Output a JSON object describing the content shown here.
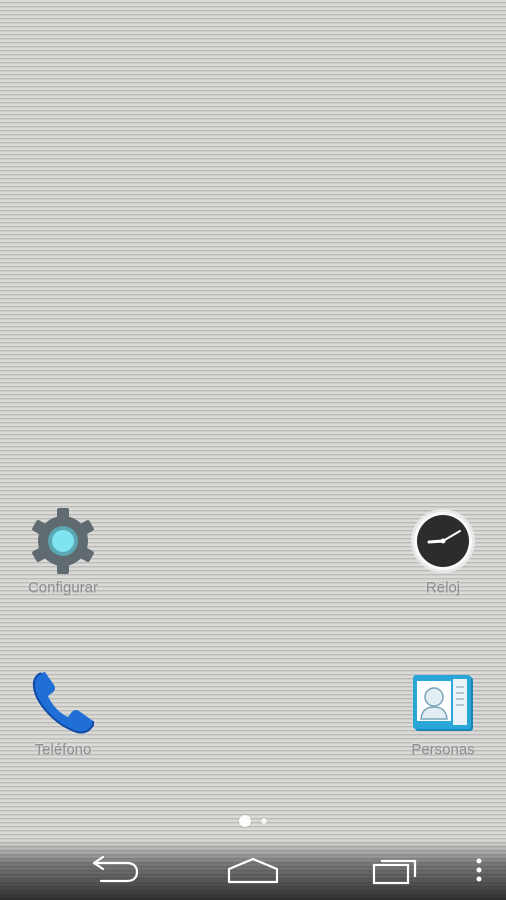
{
  "home_screen": {
    "apps": [
      {
        "id": "settings",
        "label": "Configurar",
        "icon": "settings-gear-icon"
      },
      {
        "id": "clock",
        "label": "Reloj",
        "icon": "analog-clock-icon"
      },
      {
        "id": "phone",
        "label": "Teléfono",
        "icon": "phone-handset-icon"
      },
      {
        "id": "people",
        "label": "Personas",
        "icon": "contacts-card-icon"
      }
    ],
    "pages": {
      "count": 2,
      "current": 1
    }
  },
  "navbar": {
    "buttons": [
      {
        "id": "back",
        "icon": "back-arrow-icon"
      },
      {
        "id": "home",
        "icon": "home-icon"
      },
      {
        "id": "recent",
        "icon": "recent-apps-icon"
      },
      {
        "id": "menu",
        "icon": "overflow-menu-icon"
      }
    ]
  },
  "colors": {
    "label_text": "#8e8f8f",
    "gear": "#5f6b70",
    "gear_center": "#7fe3f0",
    "phone": "#1f6fd6",
    "contacts": "#2aa7d8"
  }
}
